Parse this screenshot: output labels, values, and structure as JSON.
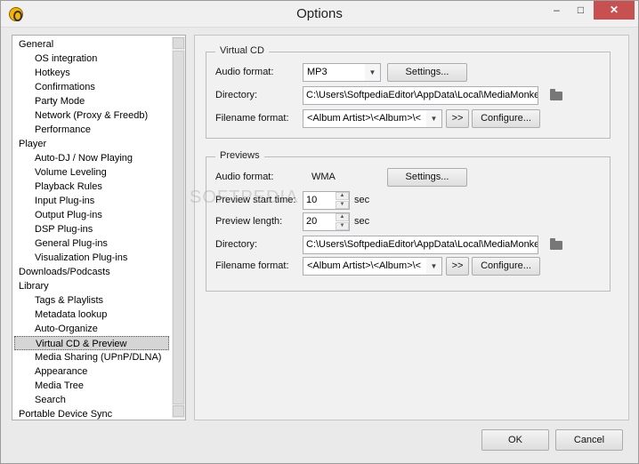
{
  "window": {
    "title": "Options",
    "minimize": "–",
    "maximize": "□",
    "close": "✕"
  },
  "tree": {
    "items": [
      {
        "label": "General",
        "level": 0
      },
      {
        "label": "OS integration",
        "level": 1
      },
      {
        "label": "Hotkeys",
        "level": 1
      },
      {
        "label": "Confirmations",
        "level": 1
      },
      {
        "label": "Party Mode",
        "level": 1
      },
      {
        "label": "Network (Proxy & Freedb)",
        "level": 1
      },
      {
        "label": "Performance",
        "level": 1
      },
      {
        "label": "Player",
        "level": 0
      },
      {
        "label": "Auto-DJ / Now Playing",
        "level": 1
      },
      {
        "label": "Volume Leveling",
        "level": 1
      },
      {
        "label": "Playback Rules",
        "level": 1
      },
      {
        "label": "Input Plug-ins",
        "level": 1
      },
      {
        "label": "Output Plug-ins",
        "level": 1
      },
      {
        "label": "DSP Plug-ins",
        "level": 1
      },
      {
        "label": "General Plug-ins",
        "level": 1
      },
      {
        "label": "Visualization Plug-ins",
        "level": 1
      },
      {
        "label": "Downloads/Podcasts",
        "level": 0
      },
      {
        "label": "Library",
        "level": 0
      },
      {
        "label": "Tags & Playlists",
        "level": 1
      },
      {
        "label": "Metadata lookup",
        "level": 1
      },
      {
        "label": "Auto-Organize",
        "level": 1
      },
      {
        "label": "Virtual CD & Preview",
        "level": 1,
        "selected": true
      },
      {
        "label": "Media Sharing (UPnP/DLNA)",
        "level": 1
      },
      {
        "label": "Appearance",
        "level": 1
      },
      {
        "label": "Media Tree",
        "level": 1
      },
      {
        "label": "Search",
        "level": 1
      },
      {
        "label": "Portable Device Sync",
        "level": 0
      }
    ]
  },
  "virtual_cd": {
    "title": "Virtual CD",
    "audio_format_label": "Audio format:",
    "audio_format_value": "MP3",
    "settings_button": "Settings...",
    "directory_label": "Directory:",
    "directory_value": "C:\\Users\\SoftpediaEditor\\AppData\\Local\\MediaMonkey",
    "filename_label": "Filename format:",
    "filename_value": "<Album Artist>\\<Album>\\<",
    "insert_button": ">>",
    "configure_button": "Configure..."
  },
  "previews": {
    "title": "Previews",
    "audio_format_label": "Audio format:",
    "audio_format_value": "WMA",
    "settings_button": "Settings...",
    "start_time_label": "Preview start time:",
    "start_time_value": "10",
    "start_time_unit": "sec",
    "length_label": "Preview length:",
    "length_value": "20",
    "length_unit": "sec",
    "directory_label": "Directory:",
    "directory_value": "C:\\Users\\SoftpediaEditor\\AppData\\Local\\MediaMonkey",
    "filename_label": "Filename format:",
    "filename_value": "<Album Artist>\\<Album>\\<",
    "insert_button": ">>",
    "configure_button": "Configure..."
  },
  "footer": {
    "ok": "OK",
    "cancel": "Cancel"
  },
  "watermark": "SOFTPEDIA"
}
